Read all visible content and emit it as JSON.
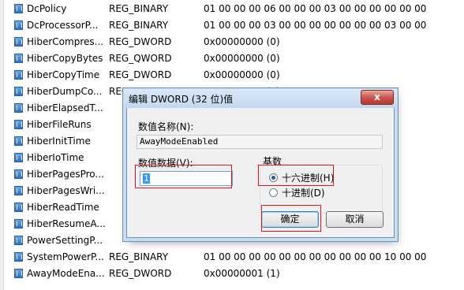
{
  "rows": [
    {
      "name": "DcPolicy",
      "type": "REG_BINARY",
      "data": "01 00 00 00 06 00 00 00 03 00 00 00 00 00 00"
    },
    {
      "name": "DcProcessorP...",
      "type": "REG_BINARY",
      "data": "01 00 00 00 03 00 00 00 00 00 00 00 03 00 00"
    },
    {
      "name": "HiberCompres...",
      "type": "REG_DWORD",
      "data": "0x00000000 (0)"
    },
    {
      "name": "HiberCopyBytes",
      "type": "REG_QWORD",
      "data": "0x00000000 (0)"
    },
    {
      "name": "HiberCopyTime",
      "type": "REG_DWORD",
      "data": "0x00000000 (0)"
    },
    {
      "name": "HiberDumpCo...",
      "type": "REG_DWORD",
      "data": "0x00000000 (0)"
    },
    {
      "name": "HiberElapsedT...",
      "type": "",
      "data": ""
    },
    {
      "name": "HiberFileRuns",
      "type": "",
      "data": ""
    },
    {
      "name": "HiberInitTime",
      "type": "",
      "data": ""
    },
    {
      "name": "HiberIoTime",
      "type": "",
      "data": ""
    },
    {
      "name": "HiberPagesPro...",
      "type": "",
      "data": ""
    },
    {
      "name": "HiberPagesWri...",
      "type": "",
      "data": ""
    },
    {
      "name": "HiberReadTime",
      "type": "",
      "data": ""
    },
    {
      "name": "HiberResumeA...",
      "type": "",
      "data": ""
    },
    {
      "name": "PowerSettingP...",
      "type": "",
      "data": ""
    },
    {
      "name": "SystemPowerP...",
      "type": "REG_BINARY",
      "data": "01 00 00 00 00 00 00 00 00 00 00 00 10 00 00"
    },
    {
      "name": "AwayModeEna...",
      "type": "REG_DWORD",
      "data": "0x00000001 (1)"
    }
  ],
  "dialog": {
    "title": "编辑 DWORD (32 位)值",
    "close": "x",
    "name_label": "数值名称(N):",
    "name_value": "AwayModeEnabled",
    "data_label": "数值数据(V):",
    "data_value": "1",
    "base_label": "基数",
    "hex_label": "十六进制(H)",
    "dec_label": "十进制(D)",
    "base_selected": "hex",
    "ok": "确定",
    "cancel": "取消"
  }
}
